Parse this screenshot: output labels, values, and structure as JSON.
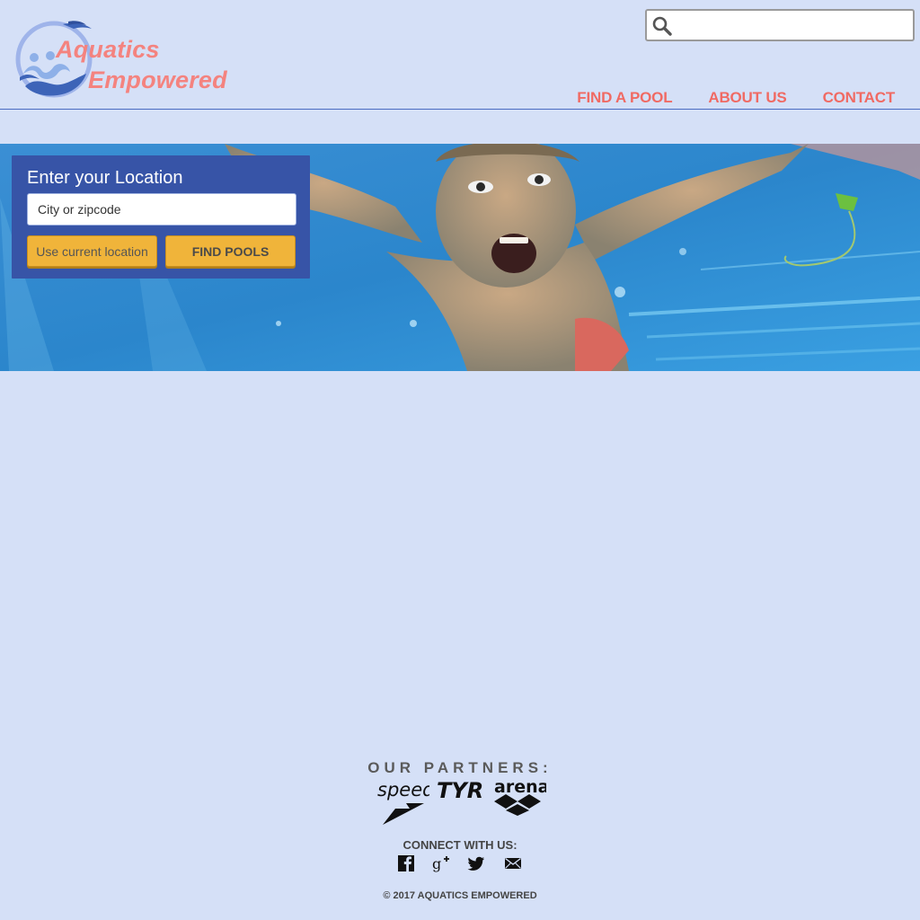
{
  "brand": {
    "line1": "Aquatics",
    "line2": "Empowered",
    "color": "#f4837f",
    "mark_color": "#3d64b8"
  },
  "search": {
    "value": "",
    "placeholder": ""
  },
  "nav": {
    "items": [
      {
        "label": "FIND A POOL"
      },
      {
        "label": "ABOUT US"
      },
      {
        "label": "CONTACT"
      }
    ],
    "color": "#f06a63"
  },
  "hero": {
    "description_image": "boy swimming underwater in pool"
  },
  "location_form": {
    "title": "Enter your Location",
    "input_placeholder": "City or zipcode",
    "input_value": "",
    "current_location_label": "Use current location",
    "find_label": "FIND POOLS",
    "panel_color": "#3754a7",
    "button_color": "#f0b43a"
  },
  "footer": {
    "partners_title": "OUR PARTNERS:",
    "partners": [
      {
        "name": "speedo"
      },
      {
        "name": "TYR"
      },
      {
        "name": "arena"
      }
    ],
    "connect_title": "CONNECT WITH US:",
    "social": [
      "facebook-icon",
      "google-plus-icon",
      "twitter-icon",
      "email-icon"
    ],
    "copyright": "© 2017 AQUATICS EMPOWERED"
  },
  "colors": {
    "background": "#d5e0f7",
    "header_rule": "#4a6cc2"
  }
}
